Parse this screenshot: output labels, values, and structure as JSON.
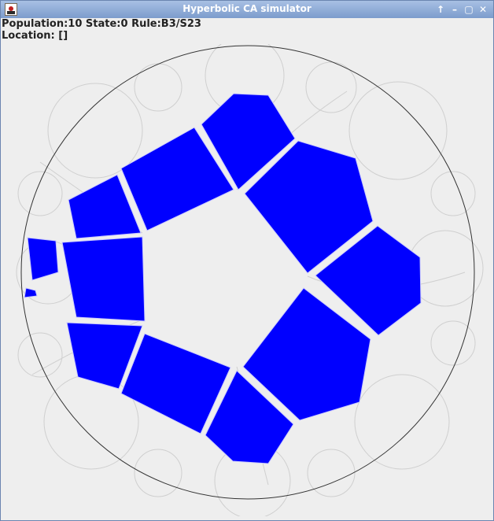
{
  "window": {
    "title": "Hyperbolic CA simulator",
    "controls": [
      "↑",
      "–",
      "▢",
      "✕"
    ]
  },
  "status": {
    "line1": "Population:10 State:0 Rule:B3/S23",
    "line2": "Location: []"
  },
  "colors": {
    "background": "#eeeeee",
    "disk_border": "#333333",
    "grid_line": "#cfcfcf",
    "live_cell": "#0000ff",
    "titlebar_top": "#a8c0e4",
    "titlebar_bottom": "#7c9ccc"
  },
  "icons": {
    "app": "java-duke-icon",
    "raise": "arrow-up-icon",
    "minimize": "minimize-icon",
    "maximize": "maximize-icon",
    "close": "close-icon"
  }
}
